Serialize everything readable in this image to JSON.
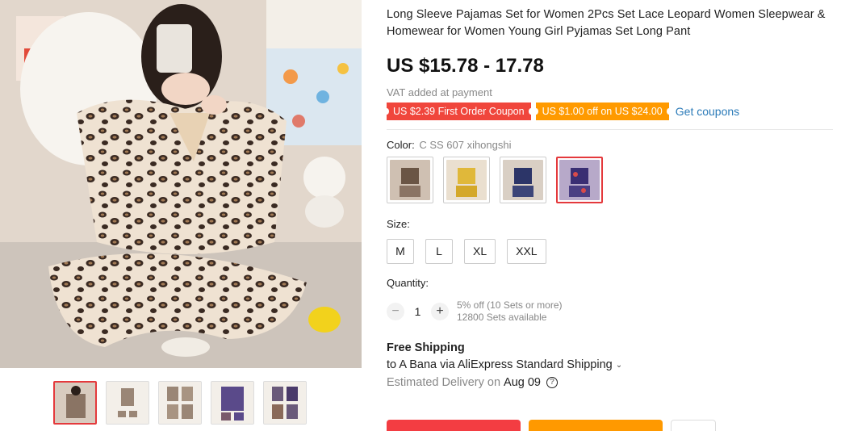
{
  "product": {
    "title": "Long Sleeve Pajamas Set for Women 2Pcs Set Lace Leopard Women Sleepwear & Homewear for Women Young Girl Pyjamas Set Long Pant",
    "price": "US $15.78 - 17.78",
    "vat": "VAT added at payment"
  },
  "coupons": {
    "items": [
      {
        "label": "US $2.39 First Order Coupon",
        "color": "#f0463c"
      },
      {
        "label": "US $1.00 off on US $24.00",
        "color": "#ff9a00"
      }
    ],
    "link": "Get coupons"
  },
  "color": {
    "label": "Color:",
    "selected": "C SS 607 xihongshi",
    "options": [
      {
        "name": "leopard-beige",
        "bg": "#b8a898",
        "accent": "#6a5545"
      },
      {
        "name": "yellow",
        "bg": "#e8d48a",
        "accent": "#c9a21e"
      },
      {
        "name": "navy-print",
        "bg": "#7a86b0",
        "accent": "#2c3568"
      },
      {
        "name": "red-print",
        "bg": "#8f7fb4",
        "accent": "#3a2e73"
      }
    ],
    "selected_index": 3
  },
  "size": {
    "label": "Size:",
    "options": [
      "M",
      "L",
      "XL",
      "XXL"
    ]
  },
  "quantity": {
    "label": "Quantity:",
    "minus": "−",
    "plus": "+",
    "value": "1",
    "discount": "5% off (10 Sets or more)",
    "available": "12800 Sets available"
  },
  "shipping": {
    "title": "Free Shipping",
    "to": "to A Bana via AliExpress Standard Shipping",
    "chevron": "⌄",
    "delivery_label": "Estimated Delivery on",
    "delivery_date": "Aug 09",
    "help": "?"
  },
  "gallery": {
    "thumb_count": 5,
    "active_index": 0
  },
  "colors": {
    "accent_red": "#e4393c",
    "buy_button": "#f33d42",
    "cart_button": "#ff9900",
    "link_blue": "#2a7ab8"
  }
}
